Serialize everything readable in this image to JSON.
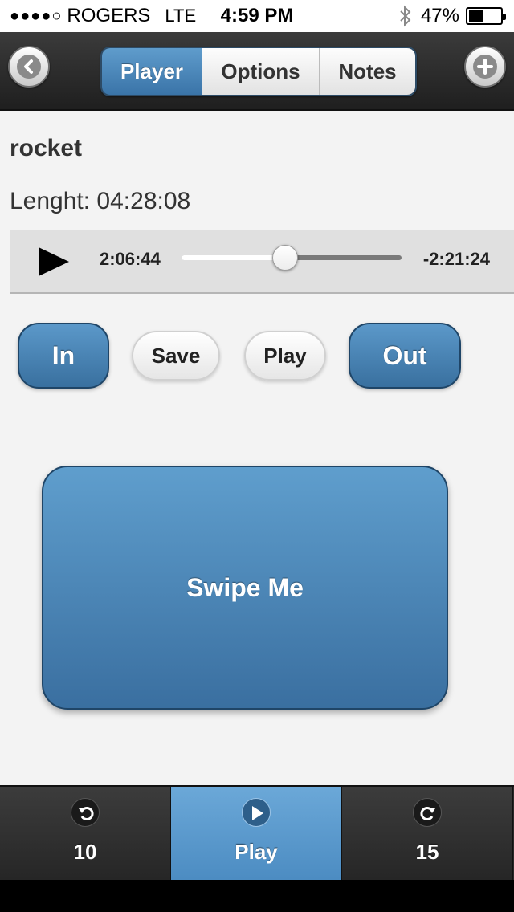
{
  "status_bar": {
    "signal_dots": "●●●●○",
    "carrier": "ROGERS",
    "network": "LTE",
    "time": "4:59 PM",
    "battery_text": "47%",
    "battery_level": 0.47,
    "bluetooth_icon": "bluetooth-icon"
  },
  "header": {
    "back_icon": "chevron-left-circle-icon",
    "add_icon": "plus-circle-icon",
    "tabs": [
      {
        "label": "Player",
        "active": true
      },
      {
        "label": "Options",
        "active": false
      },
      {
        "label": "Notes",
        "active": false
      }
    ]
  },
  "track": {
    "title": "rocket",
    "length_label": "Lenght: 04:28:08"
  },
  "player": {
    "play_icon": "play-icon",
    "elapsed": "2:06:44",
    "remaining": "-2:21:24",
    "progress": 0.472
  },
  "controls": {
    "in_label": "In",
    "save_label": "Save",
    "play_label": "Play",
    "out_label": "Out"
  },
  "swipe": {
    "label": "Swipe Me"
  },
  "tabbar": {
    "items": [
      {
        "icon": "rewind-icon",
        "label": "10",
        "active": false
      },
      {
        "icon": "play-circle-icon",
        "label": "Play",
        "active": true
      },
      {
        "icon": "forward-icon",
        "label": "15",
        "active": false
      }
    ]
  },
  "colors": {
    "accent_blue": "#3a74a8",
    "header_dark": "#2b2b2b",
    "content_bg": "#f3f3f3"
  }
}
